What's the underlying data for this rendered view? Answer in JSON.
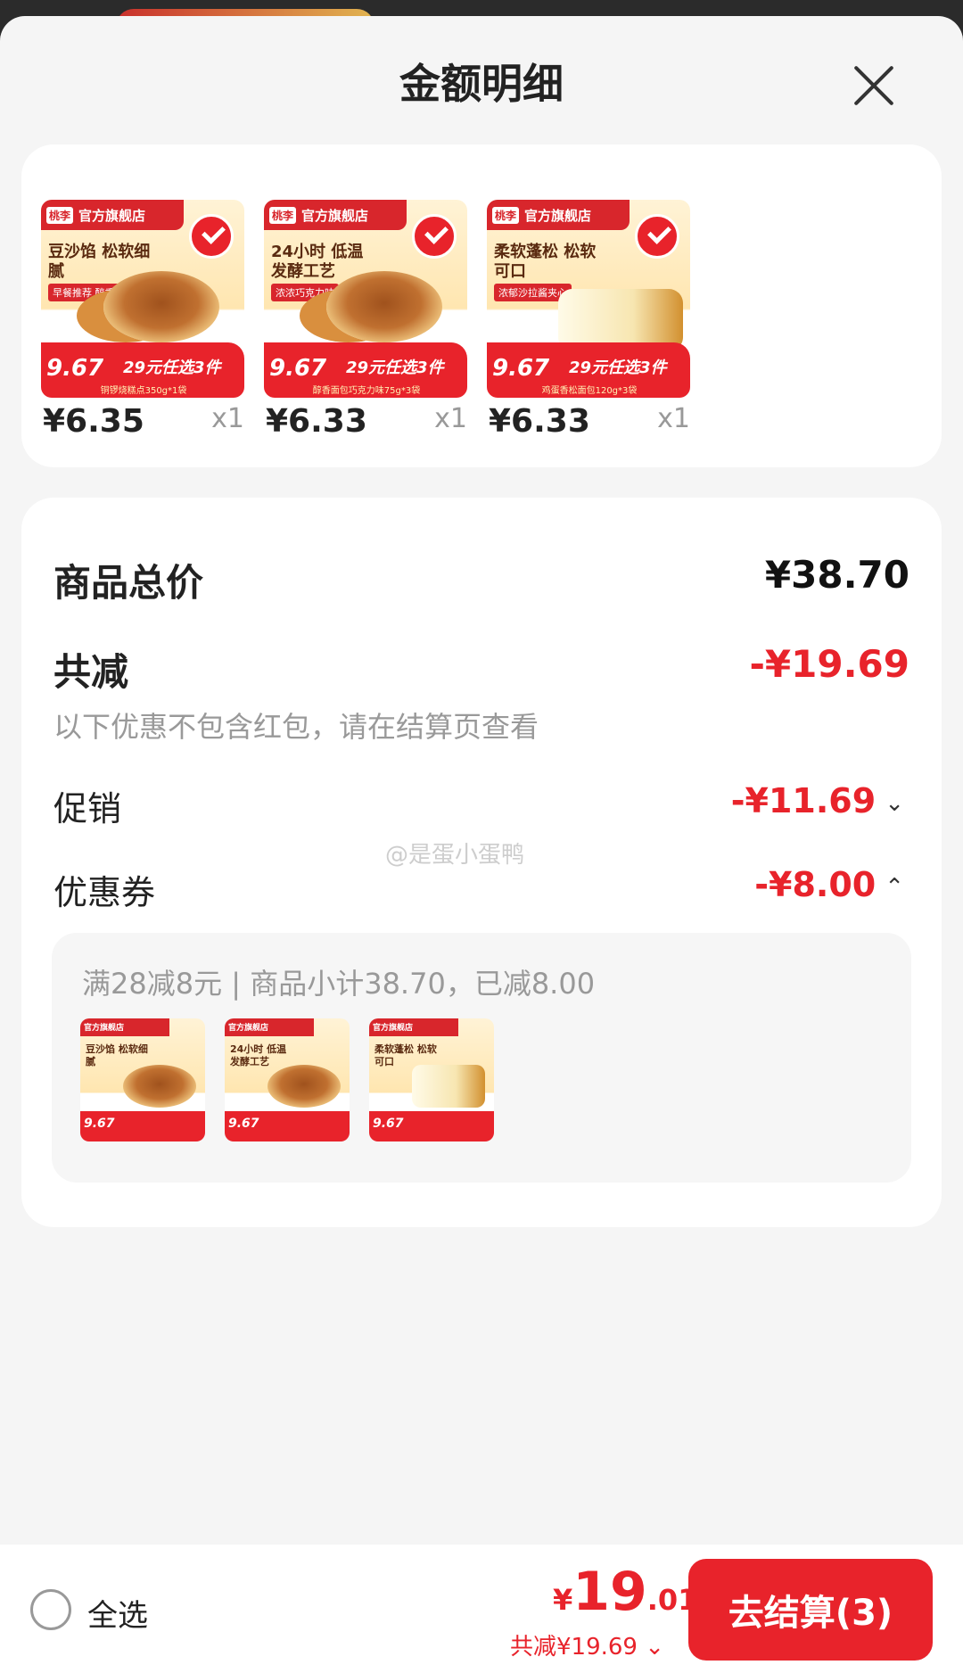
{
  "sheet": {
    "title": "金额明细"
  },
  "products": [
    {
      "brand": "官方旗舰店",
      "headline": "豆沙馅 松软细腻",
      "tag": "早餐推荐 醇香可口",
      "badge_price": "9.67",
      "promo": "29元任选3件",
      "subline": "铜锣烧糕点350g*1袋",
      "price": "¥6.35",
      "qty": "x1"
    },
    {
      "brand": "官方旗舰店",
      "headline": "24小时 低温发酵工艺",
      "tag": "浓浓巧克力味",
      "badge_price": "9.67",
      "promo": "29元任选3件",
      "subline": "醇香面包巧克力味75g*3袋",
      "price": "¥6.33",
      "qty": "x1"
    },
    {
      "brand": "官方旗舰店",
      "headline": "柔软蓬松 松软可口",
      "tag": "浓郁沙拉酱夹心",
      "badge_price": "9.67",
      "promo": "29元任选3件",
      "subline": "鸡蛋香松面包120g*3袋",
      "price": "¥6.33",
      "qty": "x1"
    }
  ],
  "detail": {
    "total_label": "商品总价",
    "total_value": "¥38.70",
    "reduce_label": "共减",
    "reduce_value": "-¥19.69",
    "reduce_note": "以下优惠不包含红包，请在结算页查看",
    "promo_label": "促销",
    "promo_value": "-¥11.69",
    "coupon_label": "优惠券",
    "coupon_value": "-¥8.00",
    "coupon_desc": "满28减8元 | 商品小计38.70，已减8.00"
  },
  "watermark": "@是蛋小蛋鸭",
  "bottom": {
    "select_all": "全选",
    "currency": "¥",
    "price_int": "19",
    "price_dec": ".01",
    "total_reduce": "共减¥19.69",
    "checkout": "去结算(3)"
  },
  "colors": {
    "accent": "#e8232b",
    "muted": "#999999"
  }
}
